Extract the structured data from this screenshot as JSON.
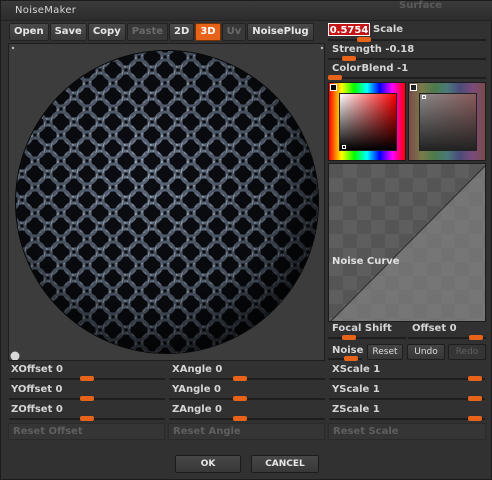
{
  "window": {
    "title": "NoiseMaker",
    "background_title": "Surface"
  },
  "toolbar": [
    {
      "label": "Open",
      "state": "normal"
    },
    {
      "label": "Save",
      "state": "normal"
    },
    {
      "label": "Copy",
      "state": "normal"
    },
    {
      "label": "Paste",
      "state": "disabled"
    },
    {
      "label": "2D",
      "state": "normal"
    },
    {
      "label": "3D",
      "state": "active"
    },
    {
      "label": "Uv",
      "state": "disabled"
    },
    {
      "label": "NoisePlug",
      "state": "normal"
    }
  ],
  "scale": {
    "value": "0.5754",
    "label": "Scale",
    "level": 0.2
  },
  "strength": {
    "label": "Strength",
    "value": "-0.18",
    "level": 0.1
  },
  "colorblend": {
    "label": "ColorBlend",
    "value": "-1",
    "level": 0.0
  },
  "curve": {
    "label": "Noise Curve"
  },
  "focal": {
    "label": "Focal Shift",
    "value": "",
    "level": 0.22
  },
  "offset": {
    "label": "Offset",
    "value": "0",
    "level": 0.95
  },
  "noise": {
    "label": "Noise",
    "reset": "Reset",
    "undo": "Undo",
    "redo": "Redo"
  },
  "params": {
    "xoffset": {
      "label": "XOffset",
      "value": "0",
      "level": 0.5
    },
    "yoffset": {
      "label": "YOffset",
      "value": "0",
      "level": 0.5
    },
    "zoffset": {
      "label": "ZOffset",
      "value": "0",
      "level": 0.5
    },
    "xangle": {
      "label": "XAngle",
      "value": "0",
      "level": 0.45
    },
    "yangle": {
      "label": "YAngle",
      "value": "0",
      "level": 0.45
    },
    "zangle": {
      "label": "ZAngle",
      "value": "0",
      "level": 0.45
    },
    "xscale": {
      "label": "XScale",
      "value": "1",
      "level": 0.98
    },
    "yscale": {
      "label": "YScale",
      "value": "1",
      "level": 0.98
    },
    "zscale": {
      "label": "ZScale",
      "value": "1",
      "level": 0.98
    }
  },
  "resets": {
    "offset": "Reset Offset",
    "angle": "Reset Angle",
    "scale": "Reset Scale"
  },
  "dialog": {
    "ok": "OK",
    "cancel": "CANCEL"
  },
  "colors": {
    "accent": "#e8631a",
    "scale_box": "#c41616"
  }
}
